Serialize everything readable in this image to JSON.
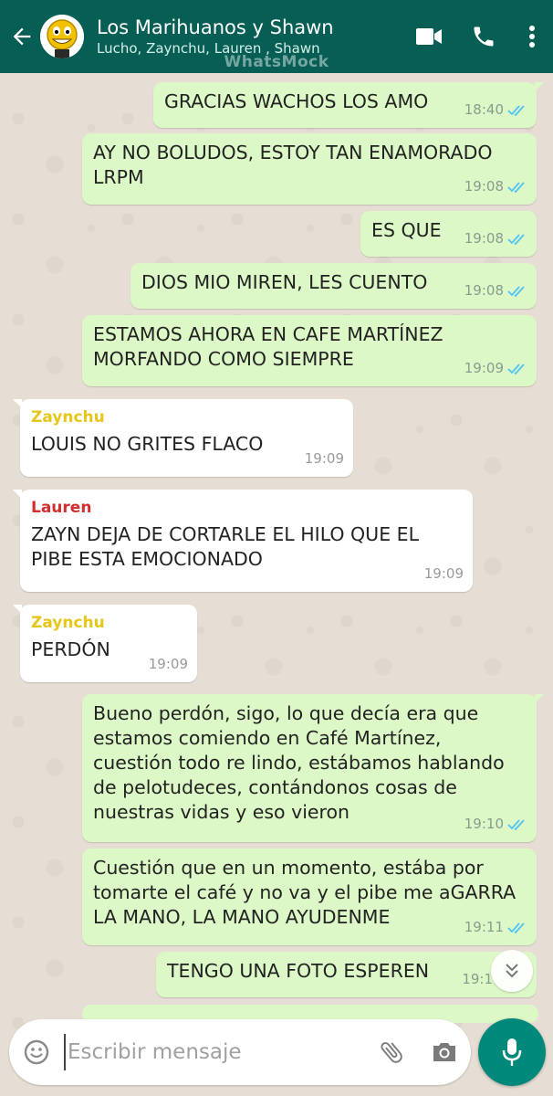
{
  "header": {
    "title": "Los Marihuanos y Shawn",
    "members": "Lucho, Zaynchu, Lauren , Shawn",
    "watermark": "WhatsMock",
    "colors": {
      "bar": "#075e54"
    }
  },
  "messages": [
    {
      "dir": "out",
      "text": "GRACIAS WACHOS LOS AMO",
      "time": "18:40",
      "read": true
    },
    {
      "dir": "out",
      "text": "AY NO BOLUDOS, ESTOY TAN ENAMORADO\nLRPM",
      "time": "19:08",
      "read": true
    },
    {
      "dir": "out",
      "text": "ES QUE",
      "time": "19:08",
      "read": true
    },
    {
      "dir": "out",
      "text": "DIOS MIO MIREN, LES CUENTO",
      "time": "19:08",
      "read": true
    },
    {
      "dir": "out",
      "text": "ESTAMOS AHORA EN CAFE MARTÍNEZ\nMORFANDO COMO SIEMPRE",
      "time": "19:09",
      "read": true
    },
    {
      "dir": "in",
      "sender": "Zaynchu",
      "sender_color": "#e6c619",
      "text": "LOUIS NO GRITES FLACO",
      "time": "19:09"
    },
    {
      "dir": "in",
      "sender": "Lauren",
      "sender_color": "#d32f2f",
      "text": "ZAYN DEJA DE CORTARLE EL HILO QUE EL\nPIBE ESTA EMOCIONADO",
      "time": "19:09"
    },
    {
      "dir": "in",
      "sender": "Zaynchu",
      "sender_color": "#e6c619",
      "text": "PERDÓN",
      "time": "19:09"
    },
    {
      "dir": "out",
      "text": "Bueno perdón, sigo, lo que decía era que\nestamos comiendo en Café Martínez,\ncuestión todo re lindo, estábamos hablando\nde pelotudeces, contándonos cosas de\nnuestras vidas y eso vieron",
      "time": "19:10",
      "read": true
    },
    {
      "dir": "out",
      "text": "Cuestión que en un momento, estába por\ntomarte el café y no va y el pibe me aGARRA\nLA MANO, LA MANO AYUDENME",
      "time": "19:11",
      "read": true
    },
    {
      "dir": "out",
      "text": "TENGO UNA FOTO ESPEREN",
      "time": "19:1",
      "read": true
    }
  ],
  "input": {
    "placeholder": "Escribir mensaje"
  },
  "icons": {
    "back": "arrow-left",
    "video": "video-camera",
    "call": "phone",
    "menu": "vertical-dots",
    "emoji": "smiley",
    "attach": "paperclip",
    "camera": "camera",
    "mic": "microphone",
    "scroll": "double-chevron-down"
  },
  "colors": {
    "outgoing": "#dcf8c6",
    "incoming": "#ffffff",
    "tick": "#4fc3f7",
    "mic_button": "#00897b"
  }
}
